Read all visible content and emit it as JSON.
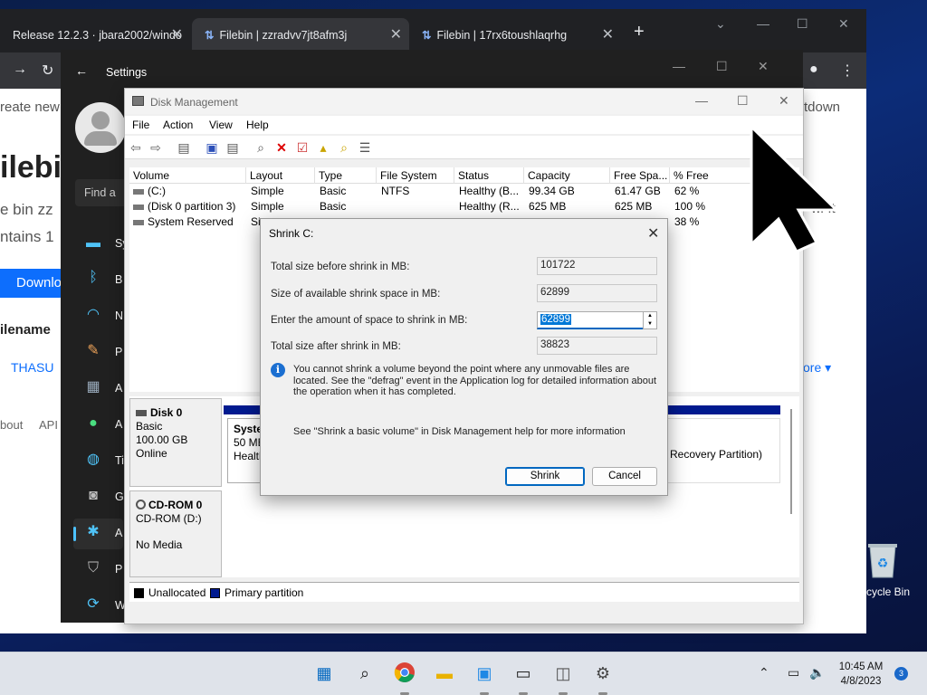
{
  "browser": {
    "tabs": [
      {
        "label": "Release 12.2.3 · jbara2002/windo"
      },
      {
        "label": "Filebin | zzradvv7jt8afm3j"
      },
      {
        "label": "Filebin | 17rx6toushlaqrhg"
      }
    ],
    "page_fragments": {
      "create": "reate new",
      "filebin": "ilebi",
      "bin": "e bin zz",
      "contains": "ntains 1",
      "download": "Downlo",
      "filename": "ilename",
      "thasu": "THASU",
      "about": "bout",
      "api": "API",
      "shutdown": "tdown",
      "right_text": "w. It",
      "more": "ore"
    }
  },
  "settings": {
    "title": "Settings",
    "find_placeholder": "Find a",
    "nav_letters": [
      "Sy",
      "B",
      "N",
      "P",
      "A",
      "A",
      "Ti",
      "G",
      "A",
      "P",
      "W"
    ]
  },
  "disk_management": {
    "title": "Disk Management",
    "menu": [
      "File",
      "Action",
      "View",
      "Help"
    ],
    "columns": [
      "Volume",
      "Layout",
      "Type",
      "File System",
      "Status",
      "Capacity",
      "Free Spa...",
      "% Free"
    ],
    "volumes": [
      {
        "volume": "(C:)",
        "layout": "Simple",
        "type": "Basic",
        "fs": "NTFS",
        "status": "Healthy (B...",
        "capacity": "99.34 GB",
        "free": "61.47 GB",
        "pct": "62 %"
      },
      {
        "volume": "(Disk 0 partition 3)",
        "layout": "Simple",
        "type": "Basic",
        "fs": "",
        "status": "Healthy (R...",
        "capacity": "625 MB",
        "free": "625 MB",
        "pct": "100 %"
      },
      {
        "volume": "System Reserved",
        "layout": "Si",
        "type": "",
        "fs": "",
        "status": "",
        "capacity": "",
        "free": "",
        "pct": "38 %"
      }
    ],
    "disks": [
      {
        "name": "Disk 0",
        "type": "Basic",
        "size": "100.00 GB",
        "status": "Online"
      },
      {
        "name": "CD-ROM 0",
        "type": "CD-ROM (D:)",
        "size": "",
        "status": "No Media"
      }
    ],
    "partitions": {
      "system_name": "Syster",
      "system_size": "50 MB",
      "system_status": "Health",
      "recovery": "Recovery Partition)"
    },
    "legend": [
      "Unallocated",
      "Primary partition"
    ],
    "colors": {
      "unallocated": "#000000",
      "primary": "#001a8f"
    }
  },
  "shrink_dialog": {
    "title": "Shrink C:",
    "fields": [
      {
        "label": "Total size before shrink in MB:",
        "value": "101722"
      },
      {
        "label": "Size of available shrink space in MB:",
        "value": "62899"
      },
      {
        "label": "Enter the amount of space to shrink in MB:",
        "value": "62899"
      },
      {
        "label": "Total size after shrink in MB:",
        "value": "38823"
      }
    ],
    "info": "You cannot shrink a volume beyond the point where any unmovable files are located. See the \"defrag\" event in the Application log for detailed information about the operation when it has completed.",
    "help": "See \"Shrink a basic volume\" in Disk Management help for more information",
    "shrink_button": "Shrink",
    "cancel_button": "Cancel"
  },
  "desktop": {
    "recycle_bin_label": "cycle Bin"
  },
  "taskbar": {
    "time": "10:45 AM",
    "date": "4/8/2023",
    "notification_count": "3"
  }
}
